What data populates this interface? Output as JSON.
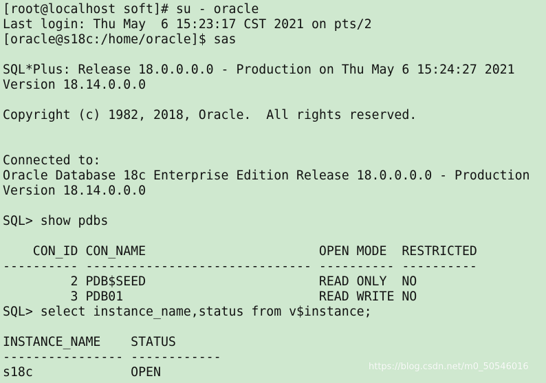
{
  "terminal": {
    "lines": [
      "[root@localhost soft]# su - oracle",
      "Last login: Thu May  6 15:23:17 CST 2021 on pts/2",
      "[oracle@s18c:/home/oracle]$ sas",
      "",
      "SQL*Plus: Release 18.0.0.0.0 - Production on Thu May 6 15:24:27 2021",
      "Version 18.14.0.0.0",
      "",
      "Copyright (c) 1982, 2018, Oracle.  All rights reserved.",
      "",
      "",
      "Connected to:",
      "Oracle Database 18c Enterprise Edition Release 18.0.0.0.0 - Production",
      "Version 18.14.0.0.0",
      "",
      "SQL> show pdbs",
      "",
      "    CON_ID CON_NAME                       OPEN MODE  RESTRICTED",
      "---------- ------------------------------ ---------- ----------",
      "         2 PDB$SEED                       READ ONLY  NO",
      "         3 PDB01                          READ WRITE NO",
      "SQL> select instance_name,status from v$instance;",
      "",
      "INSTANCE_NAME    STATUS",
      "---------------- ------------",
      "s18c             OPEN"
    ]
  },
  "watermark": "https://blog.csdn.net/m0_50546016"
}
